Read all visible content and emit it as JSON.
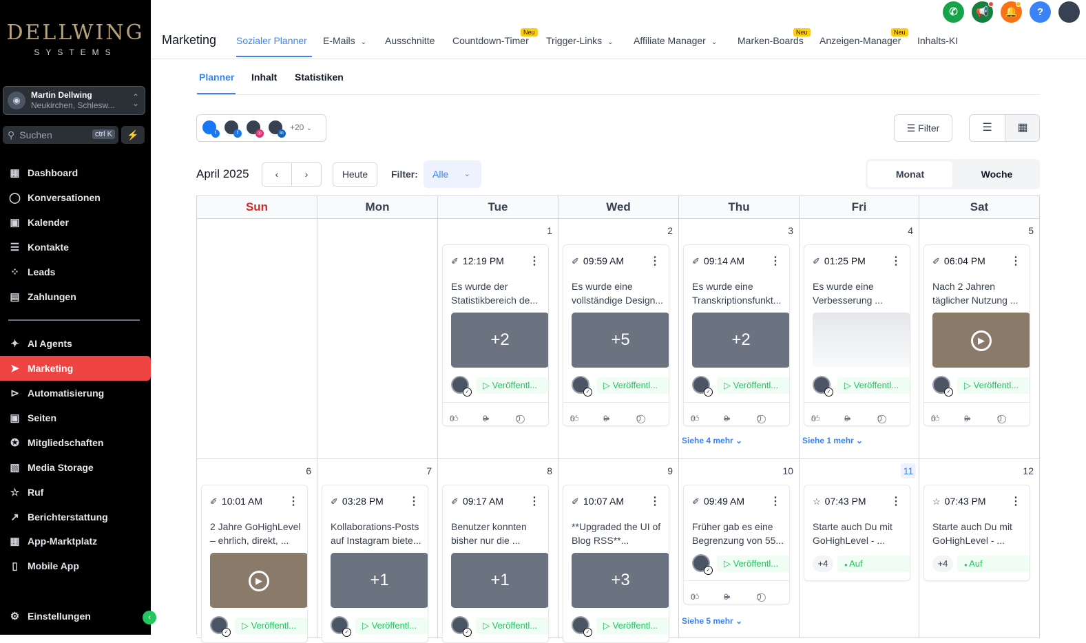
{
  "sidebar": {
    "logo_main": "DELLWING",
    "logo_sub": "SYSTEMS",
    "location": {
      "name": "Martin Dellwing",
      "sub": "Neukirchen, Schlesw..."
    },
    "search": {
      "placeholder": "Suchen",
      "shortcut": "ctrl K"
    },
    "items": [
      {
        "label": "Dashboard",
        "icon": "dashboard-icon"
      },
      {
        "label": "Konversationen",
        "icon": "chat-icon"
      },
      {
        "label": "Kalender",
        "icon": "calendar-icon"
      },
      {
        "label": "Kontakte",
        "icon": "contacts-icon"
      },
      {
        "label": "Leads",
        "icon": "leads-icon"
      },
      {
        "label": "Zahlungen",
        "icon": "payments-icon"
      },
      {
        "label": "AI Agents",
        "icon": "sparkle-icon"
      },
      {
        "label": "Marketing",
        "icon": "send-icon"
      },
      {
        "label": "Automatisierung",
        "icon": "automation-icon"
      },
      {
        "label": "Seiten",
        "icon": "pages-icon"
      },
      {
        "label": "Mitgliedschaften",
        "icon": "membership-icon"
      },
      {
        "label": "Media Storage",
        "icon": "image-icon"
      },
      {
        "label": "Ruf",
        "icon": "star-icon"
      },
      {
        "label": "Berichterstattung",
        "icon": "chart-icon"
      },
      {
        "label": "App-Marktplatz",
        "icon": "grid-icon"
      },
      {
        "label": "Mobile App",
        "icon": "phone-icon"
      },
      {
        "label": "Einstellungen",
        "icon": "gear-icon"
      }
    ]
  },
  "topbar": {
    "title": "Marketing",
    "tabs": [
      {
        "label": "Sozialer Planner"
      },
      {
        "label": "E-Mails"
      },
      {
        "label": "Ausschnitte"
      },
      {
        "label": "Countdown-Timer"
      },
      {
        "label": "Trigger-Links"
      },
      {
        "label": "Affiliate Manager"
      },
      {
        "label": "Marken-Boards"
      },
      {
        "label": "Anzeigen-Manager"
      },
      {
        "label": "Inhalts-KI"
      }
    ],
    "badge": "Neu",
    "help": "?"
  },
  "subtabs": [
    "Planner",
    "Inhalt",
    "Statistiken"
  ],
  "toolbar": {
    "accounts_more": "+20",
    "filter": "Filter",
    "month": "April 2025",
    "today": "Heute",
    "filter_label": "Filter:",
    "filter_value": "Alle",
    "view_month": "Monat",
    "view_week": "Woche"
  },
  "calendar": {
    "days": [
      "Sun",
      "Mon",
      "Tue",
      "Wed",
      "Thu",
      "Fri",
      "Sat"
    ],
    "week1": {
      "dates": [
        "",
        "",
        "1",
        "2",
        "3",
        "4",
        "5"
      ],
      "posts": [
        {
          "time": "12:19 PM",
          "l1": "Es wurde der",
          "l2": "Statistikbereich de...",
          "media": "+2",
          "status": "Veröffentl...",
          "likes": "0",
          "shares": "0",
          "comments": "0"
        },
        {
          "time": "09:59 AM",
          "l1": "Es wurde eine",
          "l2": "vollständige Design...",
          "media": "+5",
          "status": "Veröffentl...",
          "likes": "0",
          "shares": "0",
          "comments": "0"
        },
        {
          "time": "09:14 AM",
          "l1": "Es wurde eine",
          "l2": "Transkriptionsfunkt...",
          "media": "+2",
          "status": "Veröffentl...",
          "likes": "0",
          "shares": "0",
          "comments": "0"
        },
        {
          "time": "01:25 PM",
          "l1": "Es wurde eine",
          "l2": "Verbesserung ...",
          "media": "",
          "status": "Veröffentl...",
          "likes": "0",
          "shares": "0",
          "comments": "0"
        },
        {
          "time": "06:04 PM",
          "l1": "Nach 2 Jahren",
          "l2": "täglicher Nutzung ...",
          "media": "",
          "status": "Veröffentl...",
          "likes": "0",
          "shares": "0",
          "comments": "0"
        }
      ],
      "see_more_thu": "Siehe 4 mehr",
      "see_more_fri": "Siehe 1 mehr"
    },
    "week2": {
      "dates": [
        "6",
        "7",
        "8",
        "9",
        "10",
        "11",
        "12"
      ],
      "posts": [
        {
          "time": "10:01 AM",
          "l1": "2 Jahre GoHighLevel",
          "l2": "– ehrlich, direkt, ...",
          "media": "",
          "status": "Veröffentl..."
        },
        {
          "time": "03:28 PM",
          "l1": "Kollaborations-Posts",
          "l2": "auf Instagram biete...",
          "media": "+1",
          "status": "Veröffentl..."
        },
        {
          "time": "09:17 AM",
          "l1": "Benutzer konnten",
          "l2": "bisher nur die ...",
          "media": "+1",
          "status": "Veröffentl..."
        },
        {
          "time": "10:07 AM",
          "l1": "**Upgraded the UI of",
          "l2": "Blog RSS**...",
          "media": "+3",
          "status": "Veröffentl..."
        },
        {
          "time": "09:49 AM",
          "l1": "Früher gab es eine",
          "l2": "Begrenzung von 55...",
          "status": "Veröffentl...",
          "likes": "0",
          "shares": "0",
          "comments": "0"
        },
        {
          "time": "07:43 PM",
          "l1": "Starte auch Du mit",
          "l2": "GoHighLevel - ...",
          "plus": "+4",
          "status": "Auf"
        },
        {
          "time": "07:43 PM",
          "l1": "Starte auch Du mit",
          "l2": "GoHighLevel - ...",
          "plus": "+4",
          "status": "Auf"
        }
      ],
      "see_more_thu": "Siehe 5 mehr"
    }
  }
}
